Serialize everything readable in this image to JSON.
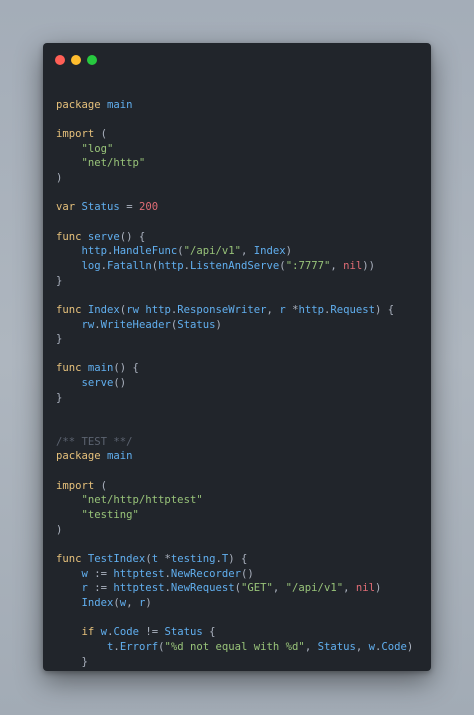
{
  "window": {
    "buttons": [
      {
        "name": "close-button",
        "color": "#ff5f56"
      },
      {
        "name": "minimize-button",
        "color": "#ffbd2e"
      },
      {
        "name": "maximize-button",
        "color": "#27c93f"
      }
    ]
  },
  "code": {
    "lines": [
      [],
      [
        [
          "kw",
          "package"
        ],
        [
          "pl",
          " "
        ],
        [
          "fn",
          "main"
        ]
      ],
      [],
      [
        [
          "kw",
          "import"
        ],
        [
          "pl",
          " ("
        ]
      ],
      [
        [
          "pl",
          "    "
        ],
        [
          "st",
          "\"log\""
        ]
      ],
      [
        [
          "pl",
          "    "
        ],
        [
          "st",
          "\"net/http\""
        ]
      ],
      [
        [
          "pl",
          ")"
        ]
      ],
      [],
      [
        [
          "kw",
          "var"
        ],
        [
          "pl",
          " "
        ],
        [
          "fn",
          "Status"
        ],
        [
          "pl",
          " = "
        ],
        [
          "nm",
          "200"
        ]
      ],
      [],
      [
        [
          "kw",
          "func"
        ],
        [
          "pl",
          " "
        ],
        [
          "fn",
          "serve"
        ],
        [
          "pl",
          "() {"
        ]
      ],
      [
        [
          "pl",
          "    "
        ],
        [
          "fn",
          "http"
        ],
        [
          "pl",
          "."
        ],
        [
          "fn",
          "HandleFunc"
        ],
        [
          "pl",
          "("
        ],
        [
          "st",
          "\"/api/v1\""
        ],
        [
          "pl",
          ", "
        ],
        [
          "fn",
          "Index"
        ],
        [
          "pl",
          ")"
        ]
      ],
      [
        [
          "pl",
          "    "
        ],
        [
          "fn",
          "log"
        ],
        [
          "pl",
          "."
        ],
        [
          "fn",
          "Fatalln"
        ],
        [
          "pl",
          "("
        ],
        [
          "fn",
          "http"
        ],
        [
          "pl",
          "."
        ],
        [
          "fn",
          "ListenAndServe"
        ],
        [
          "pl",
          "("
        ],
        [
          "st",
          "\":7777\""
        ],
        [
          "pl",
          ", "
        ],
        [
          "nm",
          "nil"
        ],
        [
          "pl",
          "))"
        ]
      ],
      [
        [
          "pl",
          "}"
        ]
      ],
      [],
      [
        [
          "kw",
          "func"
        ],
        [
          "pl",
          " "
        ],
        [
          "fn",
          "Index"
        ],
        [
          "pl",
          "("
        ],
        [
          "fn",
          "rw"
        ],
        [
          "pl",
          " "
        ],
        [
          "fn",
          "http"
        ],
        [
          "pl",
          "."
        ],
        [
          "fn",
          "ResponseWriter"
        ],
        [
          "pl",
          ", "
        ],
        [
          "fn",
          "r"
        ],
        [
          "pl",
          " *"
        ],
        [
          "fn",
          "http"
        ],
        [
          "pl",
          "."
        ],
        [
          "fn",
          "Request"
        ],
        [
          "pl",
          ") {"
        ]
      ],
      [
        [
          "pl",
          "    "
        ],
        [
          "fn",
          "rw"
        ],
        [
          "pl",
          "."
        ],
        [
          "fn",
          "WriteHeader"
        ],
        [
          "pl",
          "("
        ],
        [
          "fn",
          "Status"
        ],
        [
          "pl",
          ")"
        ]
      ],
      [
        [
          "pl",
          "}"
        ]
      ],
      [],
      [
        [
          "kw",
          "func"
        ],
        [
          "pl",
          " "
        ],
        [
          "fn",
          "main"
        ],
        [
          "pl",
          "() {"
        ]
      ],
      [
        [
          "pl",
          "    "
        ],
        [
          "fn",
          "serve"
        ],
        [
          "pl",
          "()"
        ]
      ],
      [
        [
          "pl",
          "}"
        ]
      ],
      [],
      [],
      [
        [
          "cm",
          "/** TEST **/"
        ]
      ],
      [
        [
          "kw",
          "package"
        ],
        [
          "pl",
          " "
        ],
        [
          "fn",
          "main"
        ]
      ],
      [],
      [
        [
          "kw",
          "import"
        ],
        [
          "pl",
          " ("
        ]
      ],
      [
        [
          "pl",
          "    "
        ],
        [
          "st",
          "\"net/http/httptest\""
        ]
      ],
      [
        [
          "pl",
          "    "
        ],
        [
          "st",
          "\"testing\""
        ]
      ],
      [
        [
          "pl",
          ")"
        ]
      ],
      [],
      [
        [
          "kw",
          "func"
        ],
        [
          "pl",
          " "
        ],
        [
          "fn",
          "TestIndex"
        ],
        [
          "pl",
          "("
        ],
        [
          "fn",
          "t"
        ],
        [
          "pl",
          " *"
        ],
        [
          "fn",
          "testing"
        ],
        [
          "pl",
          "."
        ],
        [
          "fn",
          "T"
        ],
        [
          "pl",
          ") {"
        ]
      ],
      [
        [
          "pl",
          "    "
        ],
        [
          "fn",
          "w"
        ],
        [
          "pl",
          " := "
        ],
        [
          "fn",
          "httptest"
        ],
        [
          "pl",
          "."
        ],
        [
          "fn",
          "NewRecorder"
        ],
        [
          "pl",
          "()"
        ]
      ],
      [
        [
          "pl",
          "    "
        ],
        [
          "fn",
          "r"
        ],
        [
          "pl",
          " := "
        ],
        [
          "fn",
          "httptest"
        ],
        [
          "pl",
          "."
        ],
        [
          "fn",
          "NewRequest"
        ],
        [
          "pl",
          "("
        ],
        [
          "st",
          "\"GET\""
        ],
        [
          "pl",
          ", "
        ],
        [
          "st",
          "\"/api/v1\""
        ],
        [
          "pl",
          ", "
        ],
        [
          "nm",
          "nil"
        ],
        [
          "pl",
          ")"
        ]
      ],
      [
        [
          "pl",
          "    "
        ],
        [
          "fn",
          "Index"
        ],
        [
          "pl",
          "("
        ],
        [
          "fn",
          "w"
        ],
        [
          "pl",
          ", "
        ],
        [
          "fn",
          "r"
        ],
        [
          "pl",
          ")"
        ]
      ],
      [],
      [
        [
          "pl",
          "    "
        ],
        [
          "kw",
          "if"
        ],
        [
          "pl",
          " "
        ],
        [
          "fn",
          "w"
        ],
        [
          "pl",
          "."
        ],
        [
          "fn",
          "Code"
        ],
        [
          "pl",
          " != "
        ],
        [
          "fn",
          "Status"
        ],
        [
          "pl",
          " {"
        ]
      ],
      [
        [
          "pl",
          "        "
        ],
        [
          "fn",
          "t"
        ],
        [
          "pl",
          "."
        ],
        [
          "fn",
          "Errorf"
        ],
        [
          "pl",
          "("
        ],
        [
          "st",
          "\"%d not equal with %d\""
        ],
        [
          "pl",
          ", "
        ],
        [
          "fn",
          "Status"
        ],
        [
          "pl",
          ", "
        ],
        [
          "fn",
          "w"
        ],
        [
          "pl",
          "."
        ],
        [
          "fn",
          "Code"
        ],
        [
          "pl",
          ")"
        ]
      ],
      [
        [
          "pl",
          "    }"
        ]
      ],
      [
        [
          "pl",
          "}"
        ]
      ]
    ]
  }
}
